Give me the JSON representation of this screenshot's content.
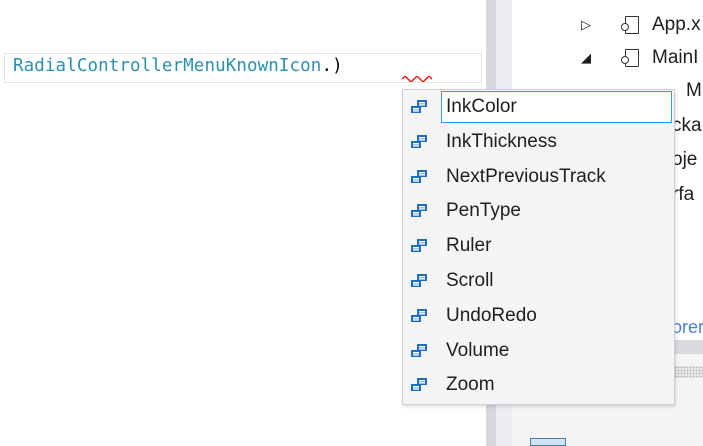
{
  "editor": {
    "code_type": "RadialControllerMenuKnownIcon",
    "code_punct": ".)"
  },
  "explorer": {
    "rows": [
      "App.x",
      "MainI",
      "M",
      "cka",
      "oje",
      "rfa"
    ],
    "link": "orer"
  },
  "completion": {
    "icon": "enum-member-icon",
    "accent_color": "#3399ff",
    "icon_color": "#1e6fc2",
    "selected_index": 0,
    "items": [
      {
        "label": "InkColor"
      },
      {
        "label": "InkThickness"
      },
      {
        "label": "NextPreviousTrack"
      },
      {
        "label": "PenType"
      },
      {
        "label": "Ruler"
      },
      {
        "label": "Scroll"
      },
      {
        "label": "UndoRedo"
      },
      {
        "label": "Volume"
      },
      {
        "label": "Zoom"
      }
    ]
  }
}
